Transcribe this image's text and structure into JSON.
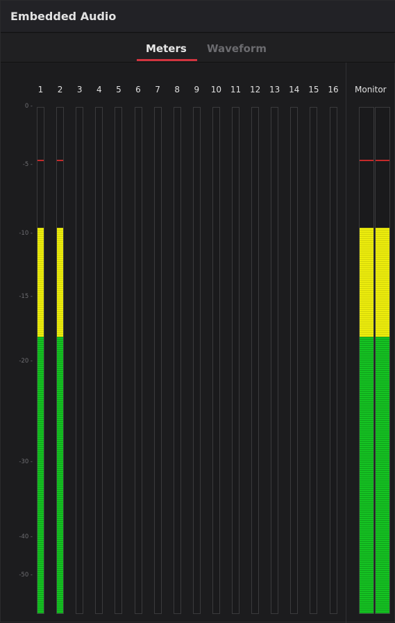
{
  "panel": {
    "title": "Embedded Audio"
  },
  "tabs": [
    {
      "label": "Meters",
      "active": true
    },
    {
      "label": "Waveform",
      "active": false
    }
  ],
  "channels": [
    {
      "label": "1",
      "level_db": -9.5,
      "peak_db": -4.5
    },
    {
      "label": "2",
      "level_db": -9.5,
      "peak_db": -4.5
    },
    {
      "label": "3",
      "level_db": null,
      "peak_db": null
    },
    {
      "label": "4",
      "level_db": null,
      "peak_db": null
    },
    {
      "label": "5",
      "level_db": null,
      "peak_db": null
    },
    {
      "label": "6",
      "level_db": null,
      "peak_db": null
    },
    {
      "label": "7",
      "level_db": null,
      "peak_db": null
    },
    {
      "label": "8",
      "level_db": null,
      "peak_db": null
    },
    {
      "label": "9",
      "level_db": null,
      "peak_db": null
    },
    {
      "label": "10",
      "level_db": null,
      "peak_db": null
    },
    {
      "label": "11",
      "level_db": null,
      "peak_db": null
    },
    {
      "label": "12",
      "level_db": null,
      "peak_db": null
    },
    {
      "label": "13",
      "level_db": null,
      "peak_db": null
    },
    {
      "label": "14",
      "level_db": null,
      "peak_db": null
    },
    {
      "label": "15",
      "level_db": null,
      "peak_db": null
    },
    {
      "label": "16",
      "level_db": null,
      "peak_db": null
    }
  ],
  "monitor": {
    "label": "Monitor",
    "channels": [
      {
        "level_db": -9.5,
        "peak_db": -4.5
      },
      {
        "level_db": -9.5,
        "peak_db": -4.5
      }
    ]
  },
  "scale_labels": [
    "0",
    "-5",
    "-10",
    "-15",
    "-20",
    "-30",
    "-40",
    "-50"
  ],
  "colors": {
    "green": "#15c322",
    "yellow": "#ecec0c",
    "peak": "#c42a2a",
    "tab_active": "#d2343f"
  },
  "zones": {
    "yellow_from_db": -18
  }
}
